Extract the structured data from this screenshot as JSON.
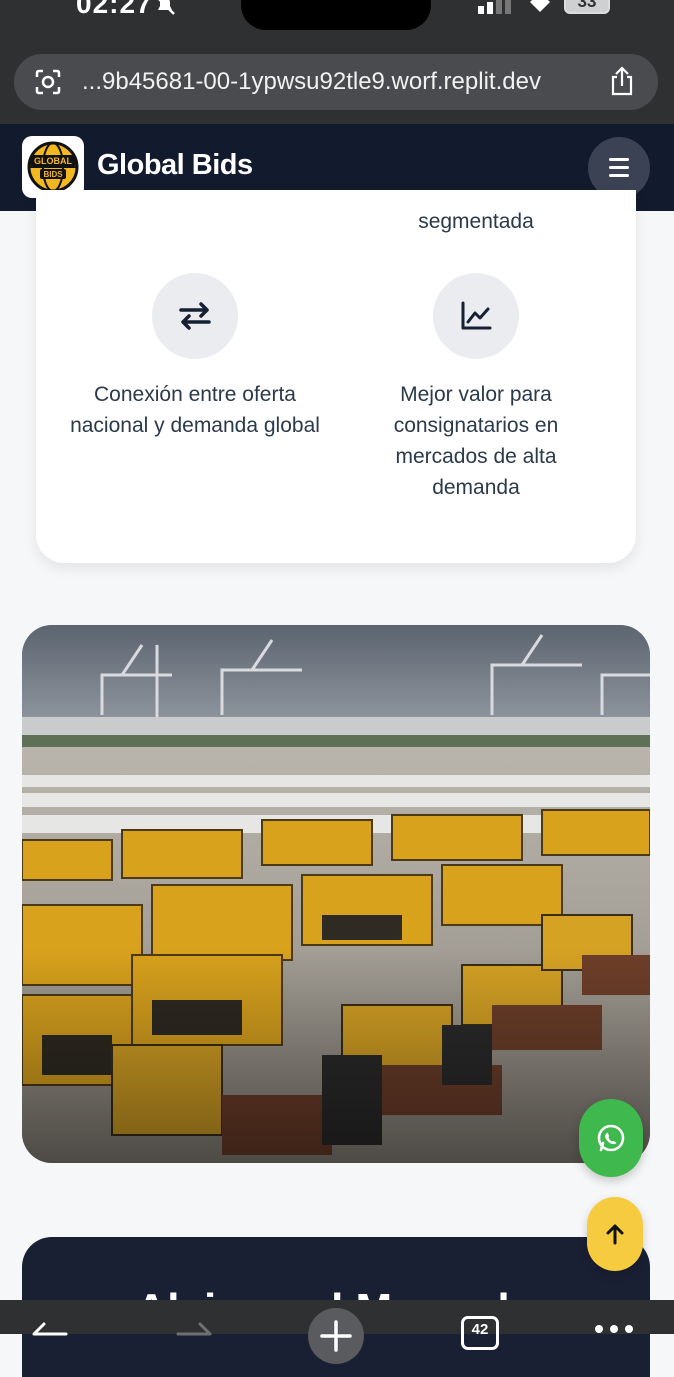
{
  "status": {
    "time": "02:27",
    "battery": "33"
  },
  "browser": {
    "url": "...9b45681-00-1ypwsu92tle9.worf.replit.dev",
    "tab_count": "42"
  },
  "header": {
    "brand": "Global Bids",
    "logo_text_top": "GLOBAL",
    "logo_text_bottom": "BIDS"
  },
  "features": {
    "partial_label": "segmentada",
    "items": [
      {
        "icon": "arrows-exchange-icon",
        "text": "Conexión entre oferta nacional y demanda global"
      },
      {
        "icon": "trend-chart-icon",
        "text": "Mejor valor para consignatarios en mercados de alta demanda"
      }
    ]
  },
  "next_section": {
    "heading": "Alcinco el Mercado"
  },
  "colors": {
    "header_bg": "#121a2e",
    "whatsapp": "#3fb84e",
    "back_to_top": "#f7cb3f",
    "text": "#2b3a4a"
  }
}
